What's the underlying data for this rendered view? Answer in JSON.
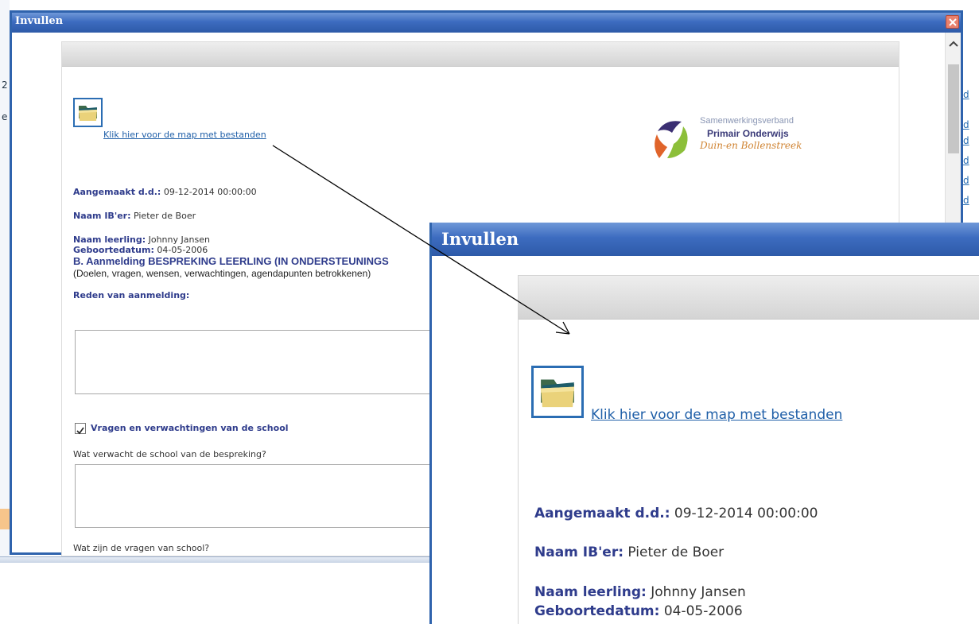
{
  "window": {
    "title": "Invullen"
  },
  "folder_link": "Klik hier voor de map met bestanden",
  "logo": {
    "line1": "Samenwerkingsverband",
    "line2": "Primair Onderwijs",
    "line3": "Duin-en Bollenstreek"
  },
  "fields": {
    "created_label": "Aangemaakt d.d.:",
    "created_value": "09-12-2014 00:00:00",
    "ib_label": "Naam IB'er:",
    "ib_value": "Pieter de Boer",
    "student_label": "Naam leerling:",
    "student_value": "Johnny Jansen",
    "birth_label": "Geboortedatum:",
    "birth_value": "04-05-2006"
  },
  "section": {
    "title": "B. Aanmelding BESPREKING LEERLING (IN ONDERSTEUNINGS",
    "subtitle": "(Doelen, vragen, wensen, verwachtingen, agendapunten betrokkenen)",
    "reason_label": "Reden van aanmelding:",
    "checkbox_label": "Vragen en verwachtingen van de school",
    "checkbox_checked": true,
    "q1_label": "Wat verwacht de school van de bespreking?",
    "q2_label": "Wat zijn de vragen van school?"
  },
  "colors": {
    "titlebar": "#3d6cc0",
    "label": "#2f3c8c",
    "link": "#1f5fa8"
  }
}
